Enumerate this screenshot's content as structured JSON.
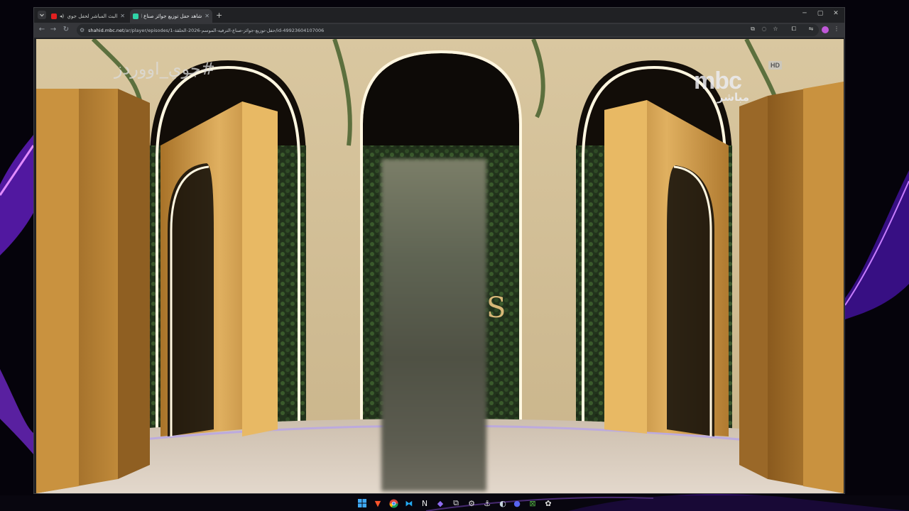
{
  "browser": {
    "tabs": [
      {
        "title": "البث المباشر لحفل جوي أوورد...",
        "active": false,
        "favicon_color": "#e02020"
      },
      {
        "title": "شاهد حفل توزيع جوائز صناع الترف...",
        "active": true,
        "favicon_color": "#2fd4a7"
      }
    ],
    "new_tab_label": "+",
    "address": {
      "host": "shahid.mbc.net",
      "path": "/ar/player/episodes/حفل-توزيع-جوائز-صناع-الترفيه-الموسم-2026-الحلقة-1/id-49923604107006"
    }
  },
  "video": {
    "hashtag": "#جوي_اووردز",
    "channel_logo": "mbc",
    "channel_live": "مباشر",
    "quality_badge": "HD",
    "stage_letter": "S"
  },
  "icons": {
    "tab_search": "tab-search-icon",
    "back": "back-arrow-icon",
    "forward": "forward-arrow-icon",
    "reload": "reload-icon",
    "site_info": "site-info-icon",
    "install": "install-app-icon",
    "eye_off": "eye-off-icon",
    "bookmark": "star-icon",
    "extensions": "puzzle-icon",
    "cast": "cast-icon",
    "menu": "kebab-menu-icon"
  },
  "taskbar": {
    "apps": [
      "windows-start-icon",
      "brave-browser-icon",
      "chrome-icon",
      "vscode-icon",
      "notion-icon",
      "obsidian-icon",
      "terminal-icon",
      "settings-icon",
      "github-icon",
      "steam-icon",
      "discord-icon",
      "xbox-icon",
      "chatgpt-icon"
    ]
  },
  "colors": {
    "accent_purple": "#8a2be2",
    "gold": "#c8923a",
    "profile": "#c058d8"
  }
}
